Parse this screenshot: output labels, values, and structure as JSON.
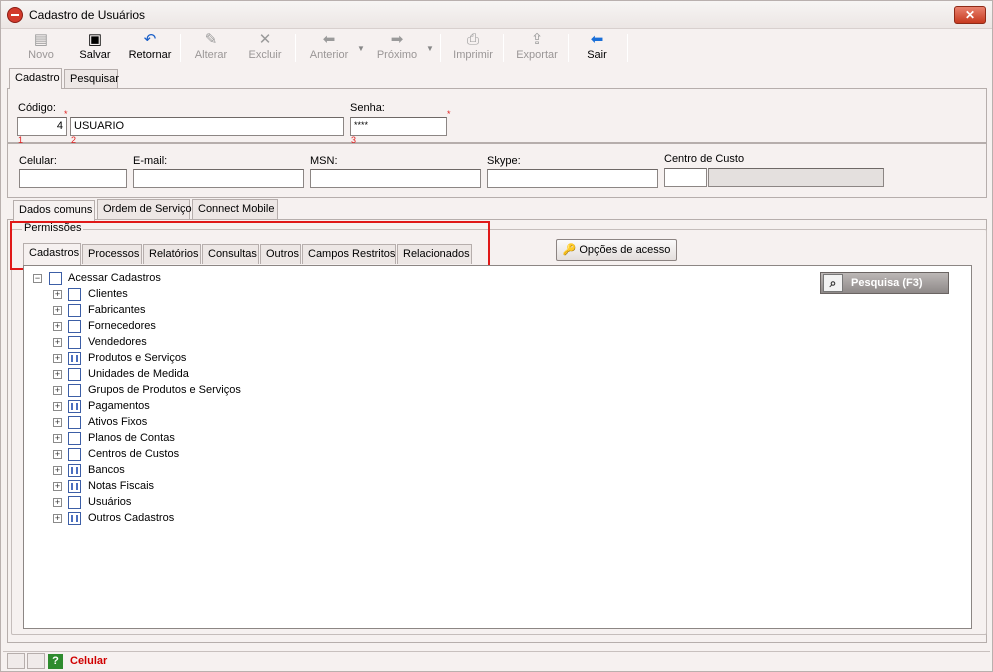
{
  "window": {
    "title": "Cadastro de Usuários",
    "close_label": "✕"
  },
  "toolbar": {
    "items": [
      {
        "label": "Novo",
        "icon": "new-icon"
      },
      {
        "label": "Salvar",
        "icon": "save-icon"
      },
      {
        "label": "Retornar",
        "icon": "undo-icon"
      },
      {
        "label": "Alterar",
        "icon": "edit-icon"
      },
      {
        "label": "Excluir",
        "icon": "delete-icon"
      },
      {
        "label": "Anterior",
        "icon": "arrow-left-icon"
      },
      {
        "label": "Próximo",
        "icon": "arrow-right-icon"
      },
      {
        "label": "Imprimir",
        "icon": "print-icon"
      },
      {
        "label": "Exportar",
        "icon": "export-icon"
      },
      {
        "label": "Sair",
        "icon": "exit-icon"
      }
    ]
  },
  "top_tabs": [
    "Cadastro",
    "Pesquisar"
  ],
  "form": {
    "codigo_label": "Código:",
    "codigo_value": "4",
    "nome_value": "USUARIO",
    "senha_label": "Senha:",
    "senha_value": "****",
    "req_star": "*",
    "idx1": "1",
    "idx2": "2",
    "idx3": "3",
    "celular_label": "Celular:",
    "email_label": "E-mail:",
    "msn_label": "MSN:",
    "skype_label": "Skype:",
    "centro_label": "Centro de Custo"
  },
  "sub_tabs": [
    "Dados comuns",
    "Ordem de Serviço",
    "Connect Mobile"
  ],
  "permissoes": {
    "title": "Permissões",
    "tabs": [
      "Cadastros",
      "Processos",
      "Relatórios",
      "Consultas",
      "Outros",
      "Campos Restritos",
      "Relacionados"
    ],
    "opcoes_label": "Opções de acesso",
    "pesquisa_label": "Pesquisa (F3)"
  },
  "tree": {
    "root": "Acessar Cadastros",
    "items": [
      {
        "label": "Clientes",
        "state": "empty"
      },
      {
        "label": "Fabricantes",
        "state": "empty"
      },
      {
        "label": "Fornecedores",
        "state": "empty"
      },
      {
        "label": "Vendedores",
        "state": "empty"
      },
      {
        "label": "Produtos e Serviços",
        "state": "partial"
      },
      {
        "label": "Unidades de Medida",
        "state": "empty"
      },
      {
        "label": "Grupos de Produtos e Serviços",
        "state": "empty"
      },
      {
        "label": "Pagamentos",
        "state": "partial"
      },
      {
        "label": "Ativos Fixos",
        "state": "empty"
      },
      {
        "label": "Planos de Contas",
        "state": "empty"
      },
      {
        "label": "Centros de Custos",
        "state": "empty"
      },
      {
        "label": "Bancos",
        "state": "partial"
      },
      {
        "label": "Notas Fiscais",
        "state": "partial"
      },
      {
        "label": "Usuários",
        "state": "empty"
      },
      {
        "label": "Outros Cadastros",
        "state": "partial"
      }
    ]
  },
  "statusbar": {
    "help": "?",
    "text": "Celular"
  }
}
